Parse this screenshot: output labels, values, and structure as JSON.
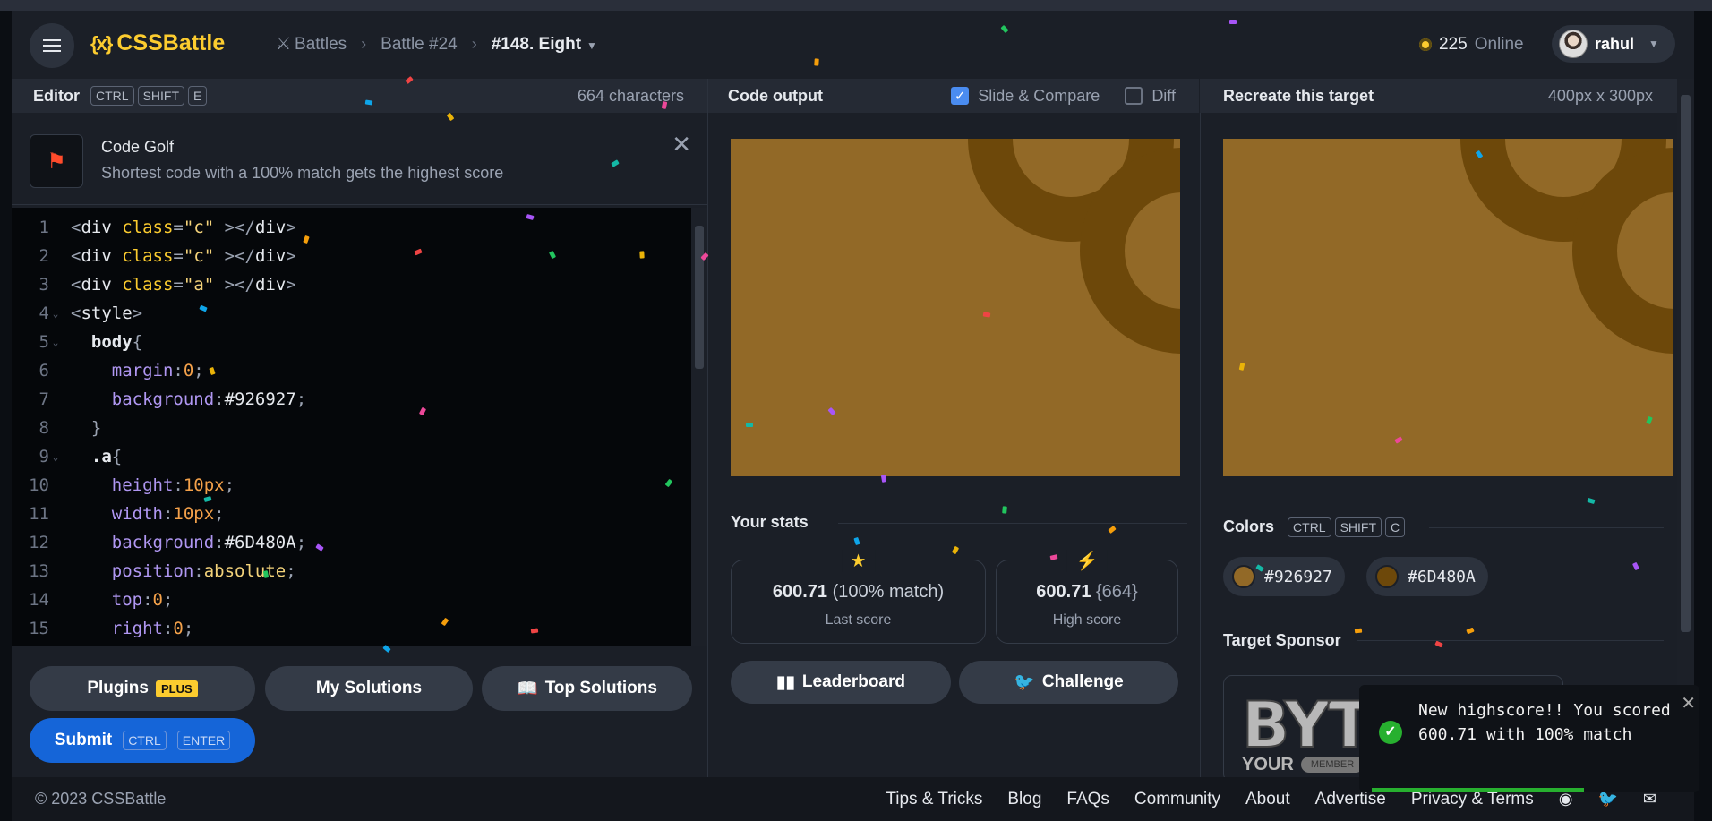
{
  "header": {
    "logo_text": "CSSBattle",
    "logo_mark": "{x}",
    "breadcrumbs": [
      "Battles",
      "Battle #24",
      "#148. Eight"
    ],
    "online_count": "225",
    "online_label": "Online",
    "username": "rahul"
  },
  "editor": {
    "title": "Editor",
    "shortcut": [
      "CTRL",
      "SHIFT",
      "E"
    ],
    "char_count": "664 characters",
    "golf_title": "Code Golf",
    "golf_subtitle": "Shortest code with a 100% match gets the highest score",
    "lines": [
      {
        "n": "1",
        "fold": ""
      },
      {
        "n": "2",
        "fold": ""
      },
      {
        "n": "3",
        "fold": ""
      },
      {
        "n": "4",
        "fold": "v"
      },
      {
        "n": "5",
        "fold": "v"
      },
      {
        "n": "6",
        "fold": ""
      },
      {
        "n": "7",
        "fold": ""
      },
      {
        "n": "8",
        "fold": ""
      },
      {
        "n": "9",
        "fold": "v"
      },
      {
        "n": "10",
        "fold": ""
      },
      {
        "n": "11",
        "fold": ""
      },
      {
        "n": "12",
        "fold": ""
      },
      {
        "n": "13",
        "fold": ""
      },
      {
        "n": "14",
        "fold": ""
      },
      {
        "n": "15",
        "fold": ""
      }
    ],
    "buttons": {
      "plugins": "Plugins",
      "plus": "PLUS",
      "my_solutions": "My Solutions",
      "top_solutions": "Top Solutions",
      "submit": "Submit",
      "submit_keys": [
        "CTRL",
        "ENTER"
      ]
    }
  },
  "output": {
    "title": "Code output",
    "slide_compare": "Slide & Compare",
    "diff": "Diff",
    "stats_title": "Your stats",
    "last_score_value": "600.71",
    "last_score_match": "(100% match)",
    "last_score_label": "Last score",
    "high_score_value": "600.71",
    "high_score_chars": "{664}",
    "high_score_label": "High score",
    "leaderboard": "Leaderboard",
    "challenge": "Challenge"
  },
  "target": {
    "title": "Recreate this target",
    "size": "400px x 300px",
    "colors_title": "Colors",
    "colors_keys": [
      "CTRL",
      "SHIFT",
      "C"
    ],
    "colors": [
      "#926927",
      "#6D480A"
    ],
    "sponsor_title": "Target Sponsor",
    "sponsor_text": "BYT",
    "sponsor_sub": "YOUR",
    "sponsor_badge": "MEMBER"
  },
  "toast": {
    "message": "New highscore!! You scored 600.71 with 100% match",
    "progress": 0.75
  },
  "footer": {
    "copyright": "© 2023 CSSBattle",
    "links": [
      "Tips & Tricks",
      "Blog",
      "FAQs",
      "Community",
      "About",
      "Advertise",
      "Privacy & Terms"
    ]
  },
  "colors": {
    "bg": "#1b1f27",
    "accent": "#fccc2f",
    "submit": "#1565d8",
    "target_bg": "#926927",
    "target_fg": "#6D480A"
  },
  "icons": [
    "menu-icon",
    "battles-icon",
    "chevron-right-icon",
    "chevron-down-icon",
    "coin-icon",
    "golf-flag-icon",
    "close-icon",
    "checkbox-icon",
    "book-icon",
    "bar-chart-icon",
    "twitter-icon",
    "star-icon",
    "bolt-icon",
    "check-icon",
    "discord-icon",
    "email-icon"
  ]
}
